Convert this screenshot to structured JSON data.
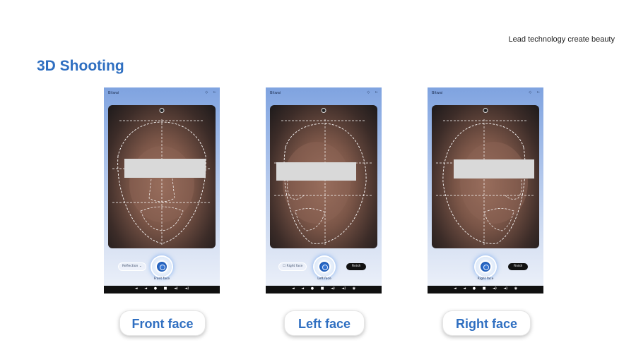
{
  "header": {
    "tagline": "Lead technology create beauty",
    "title": "3D Shooting"
  },
  "phones": [
    {
      "brand": "Bitwai",
      "top_icons": [
        "◇",
        "←"
      ],
      "left_pill": "Reflection ⌄",
      "capture_label": "Front face",
      "finish_label": "",
      "nav_icons": [
        "◄",
        "◄",
        "●",
        "■",
        "◄)",
        "◄)"
      ]
    },
    {
      "brand": "Bitwai",
      "top_icons": [
        "◇",
        "←"
      ],
      "left_pill": "☐ Right face",
      "capture_label": "Left face",
      "finish_label": "Finish",
      "nav_icons": [
        "◄",
        "◄",
        "●",
        "■",
        "◄)",
        "◄)",
        "◉"
      ]
    },
    {
      "brand": "Bitwai",
      "top_icons": [
        "◇",
        "←"
      ],
      "left_pill": "",
      "capture_label": "Right face",
      "finish_label": "Finish",
      "nav_icons": [
        "◄",
        "◄",
        "●",
        "■",
        "◄)",
        "◄)",
        "◉"
      ]
    }
  ],
  "captions": [
    "Front face",
    "Left face",
    "Right face"
  ],
  "colors": {
    "accent": "#2f6fc1",
    "finish_button": "#111111",
    "redaction": "#d9d9d9"
  }
}
